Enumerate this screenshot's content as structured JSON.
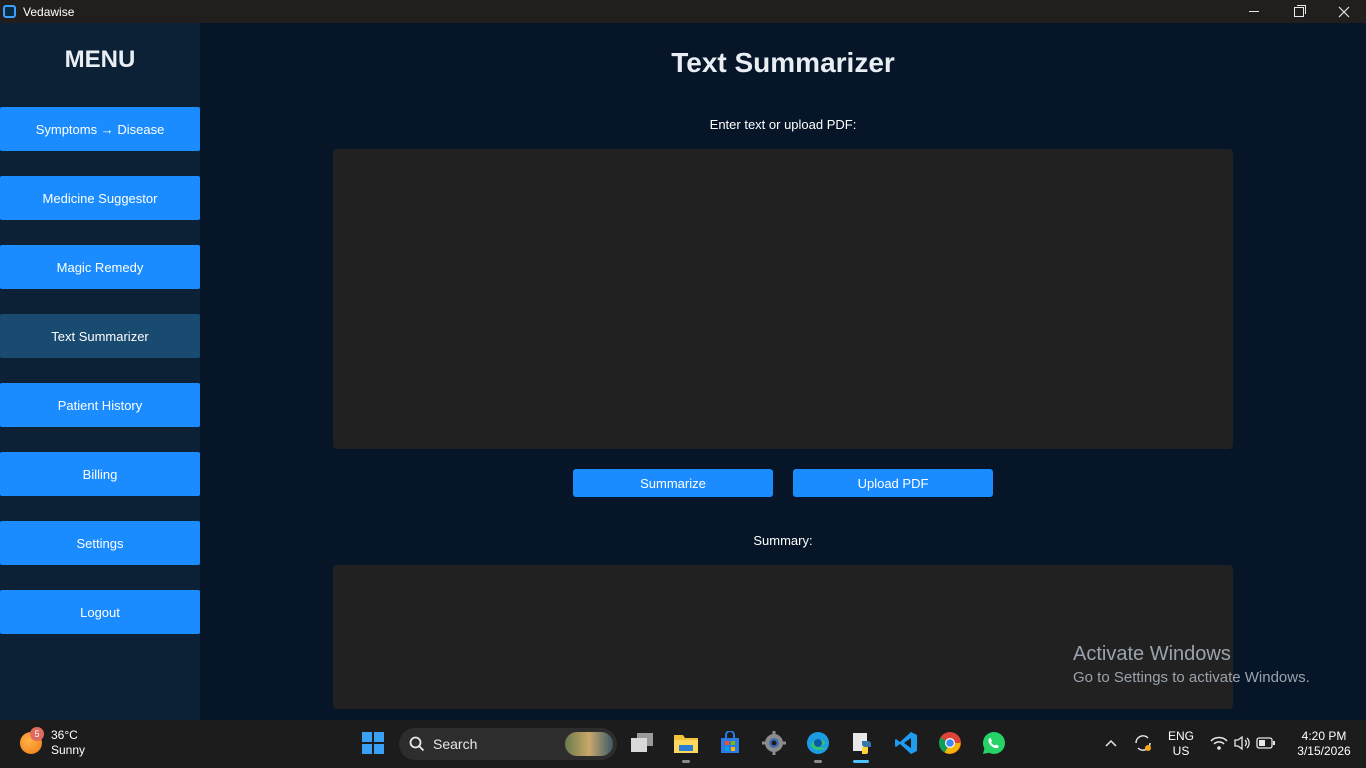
{
  "window": {
    "title": "Vedawise"
  },
  "sidebar": {
    "title": "MENU",
    "items": [
      {
        "label": "Symptoms → Disease"
      },
      {
        "label": "Medicine Suggestor"
      },
      {
        "label": "Magic Remedy"
      },
      {
        "label": "Text Summarizer"
      },
      {
        "label": "Patient History"
      },
      {
        "label": "Billing"
      },
      {
        "label": "Settings"
      },
      {
        "label": "Logout"
      }
    ],
    "active_index": 3
  },
  "main": {
    "title": "Text Summarizer",
    "input_label": "Enter text or upload PDF:",
    "input_value": "",
    "summarize_label": "Summarize",
    "upload_label": "Upload PDF",
    "summary_label": "Summary:",
    "summary_value": ""
  },
  "watermark": {
    "title": "Activate Windows",
    "subtitle": "Go to Settings to activate Windows."
  },
  "taskbar": {
    "weather_temp": "36°C",
    "weather_desc": "Sunny",
    "weather_badge": "5",
    "search_placeholder": "Search",
    "lang_top": "ENG",
    "lang_bottom": "US",
    "time": "4:20 PM",
    "date": "3/15/2026",
    "apps": [
      "start-icon",
      "task-view-icon",
      "file-explorer-icon",
      "store-icon",
      "settings-icon",
      "edge-icon",
      "python-icon",
      "vscode-icon",
      "chrome-icon",
      "whatsapp-icon"
    ]
  },
  "colors": {
    "background": "#061527",
    "sidebar": "#0c2136",
    "button": "#1a8cff",
    "active_button": "#194a70",
    "textbox": "#212121"
  }
}
